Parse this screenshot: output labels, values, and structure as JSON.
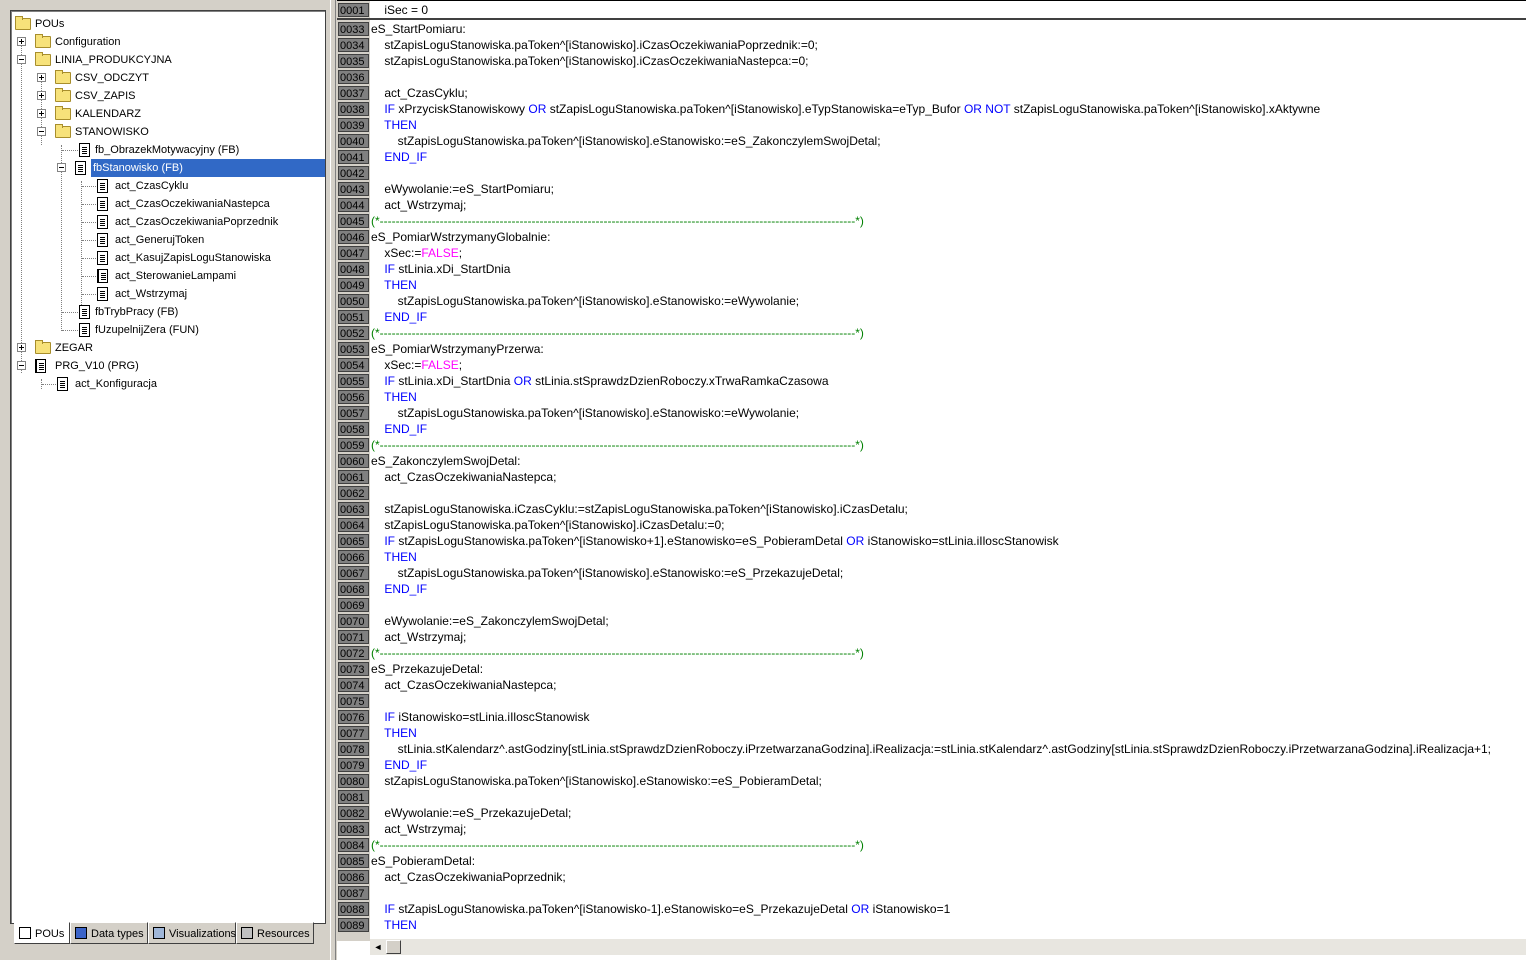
{
  "tree": {
    "root": "POUs",
    "configuration": "Configuration",
    "linia": "LINIA_PRODUKCYJNA",
    "csv_odczyt": "CSV_ODCZYT",
    "csv_zapis": "CSV_ZAPIS",
    "kalendarz": "KALENDARZ",
    "stanowisko": "STANOWISKO",
    "fb_obrazek": "fb_ObrazekMotywacyjny (FB)",
    "fb_stanowisko": "fbStanowisko (FB)",
    "act_czas_cyklu": "act_CzasCyklu",
    "act_czas_nast": "act_CzasOczekiwaniaNastepca",
    "act_czas_poprz": "act_CzasOczekiwaniaPoprzednik",
    "act_generuj": "act_GenerujToken",
    "act_kasuj": "act_KasujZapisLoguStanowiska",
    "act_sterowanie": "act_SterowanieLampami",
    "act_wstrzymaj": "act_Wstrzymaj",
    "fb_tryb": "fbTrybPracy (FB)",
    "f_uzupelnij": "fUzupelnijZera (FUN)",
    "zegar": "ZEGAR",
    "prg": "PRG_V10 (PRG)",
    "act_konfig": "act_Konfiguracja"
  },
  "tabs": {
    "pous": "POUs",
    "data_types": "Data types",
    "visualizations": "Visualizations",
    "resources": "Resources"
  },
  "code": {
    "first_num": "0001",
    "first_text": "    iSec = 0",
    "lines": [
      {
        "n": "0033",
        "t": "eS_StartPomiaru:"
      },
      {
        "n": "0034",
        "t": "    stZapisLoguStanowiska.paToken^[iStanowisko].iCzasOczekiwaniaPoprzednik:=0;"
      },
      {
        "n": "0035",
        "t": "    stZapisLoguStanowiska.paToken^[iStanowisko].iCzasOczekiwaniaNastepca:=0;"
      },
      {
        "n": "0036",
        "t": ""
      },
      {
        "n": "0037",
        "t": "    act_CzasCyklu;"
      },
      {
        "n": "0038",
        "t": "    IF xPrzyciskStanowiskowy OR stZapisLoguStanowiska.paToken^[iStanowisko].eTypStanowiska=eTyp_Bufor OR NOT stZapisLoguStanowiska.paToken^[iStanowisko].xAktywne"
      },
      {
        "n": "0039",
        "t": "    THEN"
      },
      {
        "n": "0040",
        "t": "        stZapisLoguStanowiska.paToken^[iStanowisko].eStanowisko:=eS_ZakonczylemSwojDetal;"
      },
      {
        "n": "0041",
        "t": "    END_IF"
      },
      {
        "n": "0042",
        "t": ""
      },
      {
        "n": "0043",
        "t": "    eWywolanie:=eS_StartPomiaru;"
      },
      {
        "n": "0044",
        "t": "    act_Wstrzymaj;"
      },
      {
        "n": "0045",
        "t": "(*-----------------------------------------------------------------------------------------------------------------------*)"
      },
      {
        "n": "0046",
        "t": "eS_PomiarWstrzymanyGlobalnie:"
      },
      {
        "n": "0047",
        "t": "    xSec:=FALSE;"
      },
      {
        "n": "0048",
        "t": "    IF stLinia.xDi_StartDnia"
      },
      {
        "n": "0049",
        "t": "    THEN"
      },
      {
        "n": "0050",
        "t": "        stZapisLoguStanowiska.paToken^[iStanowisko].eStanowisko:=eWywolanie;"
      },
      {
        "n": "0051",
        "t": "    END_IF"
      },
      {
        "n": "0052",
        "t": "(*-----------------------------------------------------------------------------------------------------------------------*)"
      },
      {
        "n": "0053",
        "t": "eS_PomiarWstrzymanyPrzerwa:"
      },
      {
        "n": "0054",
        "t": "    xSec:=FALSE;"
      },
      {
        "n": "0055",
        "t": "    IF stLinia.xDi_StartDnia OR stLinia.stSprawdzDzienRoboczy.xTrwaRamkaCzasowa"
      },
      {
        "n": "0056",
        "t": "    THEN"
      },
      {
        "n": "0057",
        "t": "        stZapisLoguStanowiska.paToken^[iStanowisko].eStanowisko:=eWywolanie;"
      },
      {
        "n": "0058",
        "t": "    END_IF"
      },
      {
        "n": "0059",
        "t": "(*-----------------------------------------------------------------------------------------------------------------------*)"
      },
      {
        "n": "0060",
        "t": "eS_ZakonczylemSwojDetal:"
      },
      {
        "n": "0061",
        "t": "    act_CzasOczekiwaniaNastepca;"
      },
      {
        "n": "0062",
        "t": ""
      },
      {
        "n": "0063",
        "t": "    stZapisLoguStanowiska.iCzasCyklu:=stZapisLoguStanowiska.paToken^[iStanowisko].iCzasDetalu;"
      },
      {
        "n": "0064",
        "t": "    stZapisLoguStanowiska.paToken^[iStanowisko].iCzasDetalu:=0;"
      },
      {
        "n": "0065",
        "t": "    IF stZapisLoguStanowiska.paToken^[iStanowisko+1].eStanowisko=eS_PobieramDetal OR iStanowisko=stLinia.iIloscStanowisk"
      },
      {
        "n": "0066",
        "t": "    THEN"
      },
      {
        "n": "0067",
        "t": "        stZapisLoguStanowiska.paToken^[iStanowisko].eStanowisko:=eS_PrzekazujeDetal;"
      },
      {
        "n": "0068",
        "t": "    END_IF"
      },
      {
        "n": "0069",
        "t": ""
      },
      {
        "n": "0070",
        "t": "    eWywolanie:=eS_ZakonczylemSwojDetal;"
      },
      {
        "n": "0071",
        "t": "    act_Wstrzymaj;"
      },
      {
        "n": "0072",
        "t": "(*-----------------------------------------------------------------------------------------------------------------------*)"
      },
      {
        "n": "0073",
        "t": "eS_PrzekazujeDetal:"
      },
      {
        "n": "0074",
        "t": "    act_CzasOczekiwaniaNastepca;"
      },
      {
        "n": "0075",
        "t": ""
      },
      {
        "n": "0076",
        "t": "    IF iStanowisko=stLinia.iIloscStanowisk"
      },
      {
        "n": "0077",
        "t": "    THEN"
      },
      {
        "n": "0078",
        "t": "        stLinia.stKalendarz^.astGodziny[stLinia.stSprawdzDzienRoboczy.iPrzetwarzanaGodzina].iRealizacja:=stLinia.stKalendarz^.astGodziny[stLinia.stSprawdzDzienRoboczy.iPrzetwarzanaGodzina].iRealizacja+1;"
      },
      {
        "n": "0079",
        "t": "    END_IF"
      },
      {
        "n": "0080",
        "t": "    stZapisLoguStanowiska.paToken^[iStanowisko].eStanowisko:=eS_PobieramDetal;"
      },
      {
        "n": "0081",
        "t": ""
      },
      {
        "n": "0082",
        "t": "    eWywolanie:=eS_PrzekazujeDetal;"
      },
      {
        "n": "0083",
        "t": "    act_Wstrzymaj;"
      },
      {
        "n": "0084",
        "t": "(*-----------------------------------------------------------------------------------------------------------------------*)"
      },
      {
        "n": "0085",
        "t": "eS_PobieramDetal:"
      },
      {
        "n": "0086",
        "t": "    act_CzasOczekiwaniaPoprzednik;"
      },
      {
        "n": "0087",
        "t": ""
      },
      {
        "n": "0088",
        "t": "    IF stZapisLoguStanowiska.paToken^[iStanowisko-1].eStanowisko=eS_PrzekazujeDetal OR iStanowisko=1"
      },
      {
        "n": "0089",
        "t": "    THEN"
      }
    ]
  },
  "colors": {
    "keyword": "#0000ff",
    "boolean": "#ff00ff",
    "comment": "#008000",
    "selection": "#3169c6"
  },
  "icons": {
    "folder": "folder-icon",
    "pou": "document-icon",
    "program": "program-icon"
  }
}
